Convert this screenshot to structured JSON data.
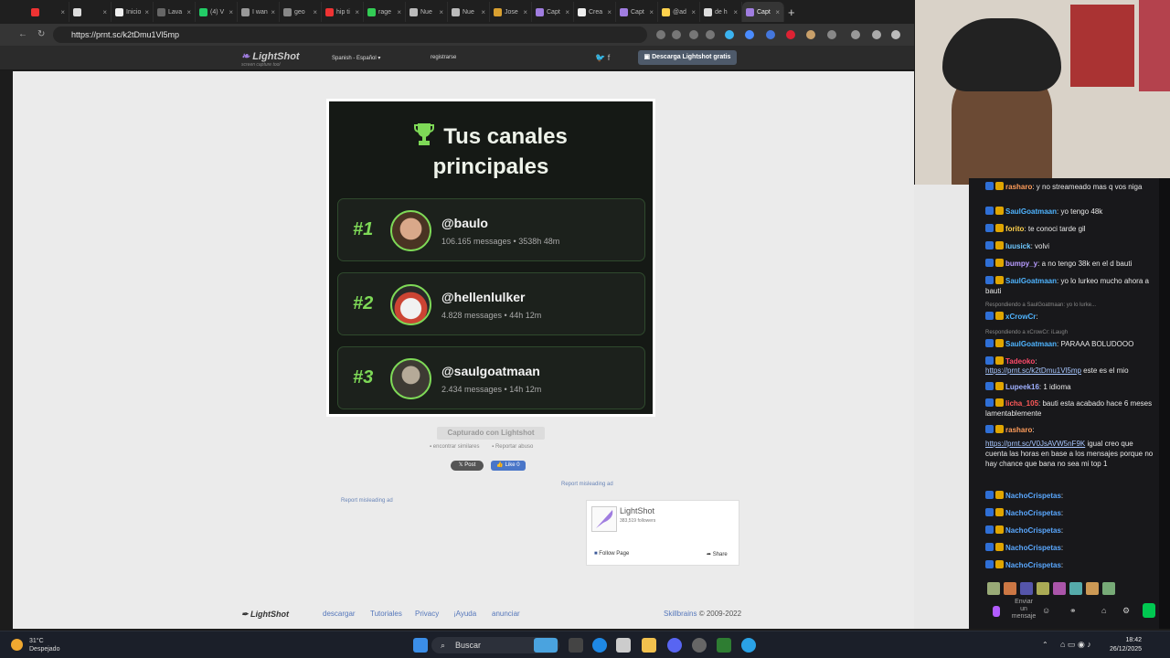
{
  "browser": {
    "tabs": [
      "",
      "",
      "Inicio",
      "Lava",
      "(4) V",
      "I wan",
      "geo",
      "hip ti",
      "rage",
      "Nue",
      "Nue",
      "Jose",
      "Capt",
      "Crea",
      "Capt",
      "@ad",
      "de h",
      "Capt"
    ],
    "active_tab_index": 17,
    "url": "https://prnt.sc/k2tDmu1Vl5mp"
  },
  "lightshot": {
    "logo": "LightShot",
    "logo_sub": "screen capture tool",
    "language": "Spanish - Español",
    "register": "registrarse",
    "download_button": "Descarga Lightshot gratis",
    "caption": "Capturado con Lightshot",
    "find_similar": "encontrar similares",
    "report_abuse": "Reportar abuso",
    "post_button": "Post",
    "like_button": "Like 0",
    "ad_report_1": "Report misleading ad",
    "ad_report_2": "Report misleading ad",
    "fb": {
      "name": "LightShot",
      "followers": "383,519 followers",
      "follow": "Follow Page",
      "share": "Share"
    },
    "footer": {
      "logo": "LightShot",
      "links": [
        "descargar",
        "Tutoriales",
        "Privacy",
        "¡Ayuda",
        "anunciar"
      ],
      "copyright_brand": "Skillbrains",
      "copyright": "© 2009-2022"
    }
  },
  "screenshot": {
    "title_line1": "Tus canales",
    "title_line2": "principales",
    "ranks": [
      {
        "rank": "#1",
        "name": "@baulo",
        "stats": "106.165 messages • 3538h 48m"
      },
      {
        "rank": "#2",
        "name": "@hellenlulker",
        "stats": "4.828 messages • 44h 12m"
      },
      {
        "rank": "#3",
        "name": "@saulgoatmaan",
        "stats": "2.434 messages • 14h 12m"
      }
    ]
  },
  "chat": {
    "messages": [
      {
        "user": "rasharo",
        "text": ": y no streameado mas q vos niga",
        "color": "#ff9c5a"
      },
      {
        "user": "SaulGoatmaan",
        "text": ": yo tengo 48k",
        "color": "#4fb4ff"
      },
      {
        "user": "forito",
        "text": ": te conoci tarde gil",
        "color": "#ffd24d"
      },
      {
        "user": "luusick",
        "text": ": volvi",
        "color": "#6ec8ff"
      },
      {
        "user": "bumpy_y",
        "text": ": a no tengo 38k en el d bauti",
        "color": "#b89cff"
      },
      {
        "user": "SaulGoatmaan",
        "text": ": yo lo lurkeo mucho ahora a bauti",
        "color": "#4fb4ff"
      },
      {
        "reply": "Respondiendo a SaulGoatmaan: yo lo lurke..."
      },
      {
        "user": "xCrowCr",
        "text": ":",
        "color": "#4fb4ff"
      },
      {
        "reply": "Respondiendo a xCrowCr: iLaugh"
      },
      {
        "user": "SaulGoatmaan",
        "text": ": PARAAA BOLUDOOO",
        "color": "#4fb4ff"
      },
      {
        "user": "Tadeoko",
        "text": ":",
        "color": "#ff4a6a"
      },
      {
        "link": "https://prnt.sc/k2tDmu1Vl5mp",
        "text": " este es el mio"
      },
      {
        "user": "Lupeek16",
        "text": ": 1 idioma",
        "color": "#9fb0ff"
      },
      {
        "user": "licha_105",
        "text": ": bauti esta acabado hace 6 meses lamentablemente",
        "color": "#ff5a5a"
      },
      {
        "user": "rasharo",
        "text": ":",
        "color": "#ff9c5a"
      },
      {
        "link": "https://prnt.sc/V0JsAVW5nF9K",
        "text": " igual creo que cuenta las horas en base a los mensajes porque no hay chance que bana no sea mi top 1"
      },
      {
        "user": "NachoCrispetas",
        "text": ":",
        "color": "#5aa8ff"
      },
      {
        "user": "NachoCrispetas",
        "text": ":",
        "color": "#5aa8ff"
      },
      {
        "user": "NachoCrispetas",
        "text": ":",
        "color": "#5aa8ff"
      },
      {
        "user": "NachoCrispetas",
        "text": ":",
        "color": "#5aa8ff"
      },
      {
        "user": "NachoCrispetas",
        "text": ":",
        "color": "#5aa8ff"
      }
    ],
    "input_placeholder": "Enviar un mensaje"
  },
  "taskbar": {
    "temperature": "31°C",
    "condition": "Despejado",
    "search": "Buscar",
    "time": "18:42",
    "date": "26/12/2025"
  }
}
